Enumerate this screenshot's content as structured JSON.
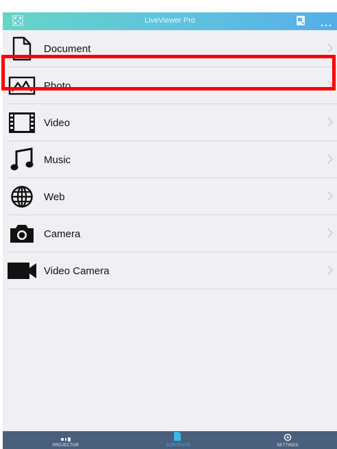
{
  "header": {
    "title": "LiveViewer Pro",
    "left_icon": "qr-code-icon",
    "right_icons": [
      "screen-share-icon",
      "more-icon"
    ]
  },
  "menu": {
    "items": [
      {
        "label": "Document",
        "icon": "document-icon"
      },
      {
        "label": "Photo",
        "icon": "photo-icon",
        "highlighted": true
      },
      {
        "label": "Video",
        "icon": "film-icon"
      },
      {
        "label": "Music",
        "icon": "music-note-icon"
      },
      {
        "label": "Web",
        "icon": "globe-icon"
      },
      {
        "label": "Camera",
        "icon": "camera-icon"
      },
      {
        "label": "Video Camera",
        "icon": "video-camera-icon"
      }
    ]
  },
  "tabbar": {
    "tabs": [
      {
        "label": "PROJECTOR",
        "icon": "projector-icon"
      },
      {
        "label": "CONTENTS",
        "icon": "contents-icon",
        "active": true
      },
      {
        "label": "SETTINGS",
        "icon": "settings-icon"
      }
    ]
  },
  "colors": {
    "header_start": "#67d4c8",
    "header_end": "#55aee9",
    "tabbar": "#4a5f7c",
    "active_tab": "#38b9ea",
    "highlight": "#ff0000"
  }
}
